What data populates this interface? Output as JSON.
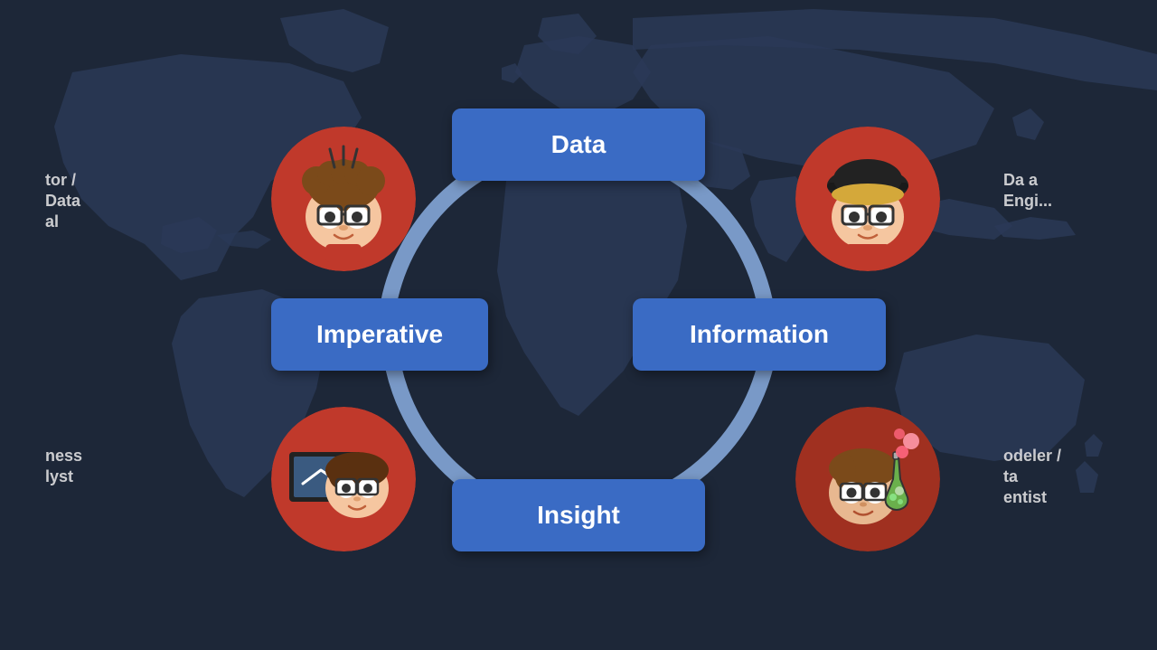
{
  "background": {
    "color": "#1a1a2e"
  },
  "diagram": {
    "boxes": {
      "data": {
        "label": "Data"
      },
      "information": {
        "label": "Information"
      },
      "insight": {
        "label": "Insight"
      },
      "imperative": {
        "label": "Imperative"
      }
    },
    "avatars": {
      "top_left": {
        "role": "Data Analyst",
        "label_line1": "tor /",
        "label_line2": "Data",
        "label_line3": "al"
      },
      "top_right": {
        "role": "Data Engineer",
        "label_line1": "Data",
        "label_line2": "Engi..."
      },
      "bottom_left": {
        "role": "Business Analyst",
        "label_line1": "ness",
        "label_line2": "lyst"
      },
      "bottom_right": {
        "role": "Modeler / Data Scientist",
        "label_line1": "odeler /",
        "label_line2": "ta",
        "label_line3": "entist"
      }
    },
    "circle_color": "#a0b8e8",
    "box_color": "#3a6bc4",
    "box_text_color": "#ffffff"
  }
}
